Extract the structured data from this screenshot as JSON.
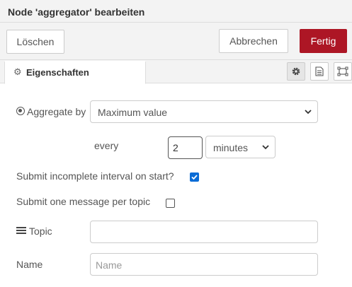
{
  "window": {
    "title": "Node 'aggregator' bearbeiten"
  },
  "toolbar": {
    "delete_label": "Löschen",
    "cancel_label": "Abbrechen",
    "done_label": "Fertig"
  },
  "tabs": [
    {
      "label": "Eigenschaften",
      "icon": "gear-icon",
      "active": true
    }
  ],
  "side_buttons": [
    {
      "icon": "gear-icon",
      "active": true
    },
    {
      "icon": "document-icon",
      "active": false
    },
    {
      "icon": "frame-icon",
      "active": false
    }
  ],
  "form": {
    "aggregate": {
      "label": "Aggregate by",
      "value": "Maximum value"
    },
    "every": {
      "label": "every",
      "value": "2",
      "unit": "minutes"
    },
    "submit_incomplete": {
      "label": "Submit incomplete interval on start?",
      "checked": true
    },
    "submit_per_topic": {
      "label": "Submit one message per topic",
      "checked": false
    },
    "topic": {
      "label": "Topic",
      "value": "",
      "placeholder": ""
    },
    "name": {
      "label": "Name",
      "value": "",
      "placeholder": "Name"
    }
  },
  "colors": {
    "primary": "#ad1625",
    "checkbox": "#0a6cd6",
    "panel": "#f3f3f3"
  }
}
